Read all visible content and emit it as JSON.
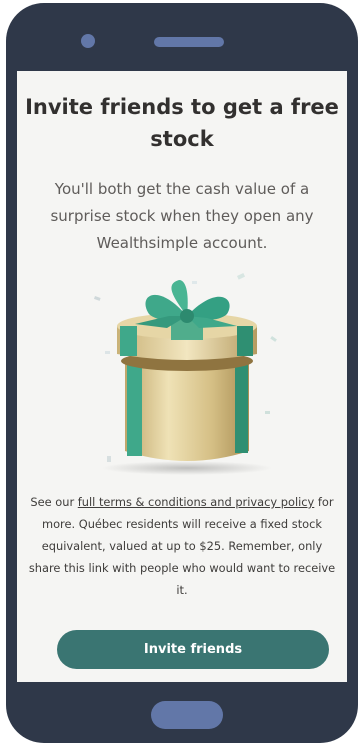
{
  "invite": {
    "title": "Invite friends to get a free stock",
    "subtitle": "You'll both get the cash value of a surprise stock when they open any Wealthsimple account.",
    "disclaimer_prefix": "See our ",
    "terms_link": "full terms & conditions and privacy policy",
    "disclaimer_suffix": " for more. Québec residents will receive a fixed stock equivalent, valued at up to $25. Remember, only share this link with people who would want to receive it.",
    "cta_label": "Invite friends"
  },
  "colors": {
    "phone_body": "#2f3849",
    "phone_accent": "#6277a8",
    "screen_bg": "#f5f5f3",
    "cta": "#3a7572",
    "ribbon": "#3fa88a",
    "gold": "#d8c48e"
  },
  "icons": [
    "gift-box-illustration",
    "camera",
    "speaker",
    "home-button"
  ]
}
